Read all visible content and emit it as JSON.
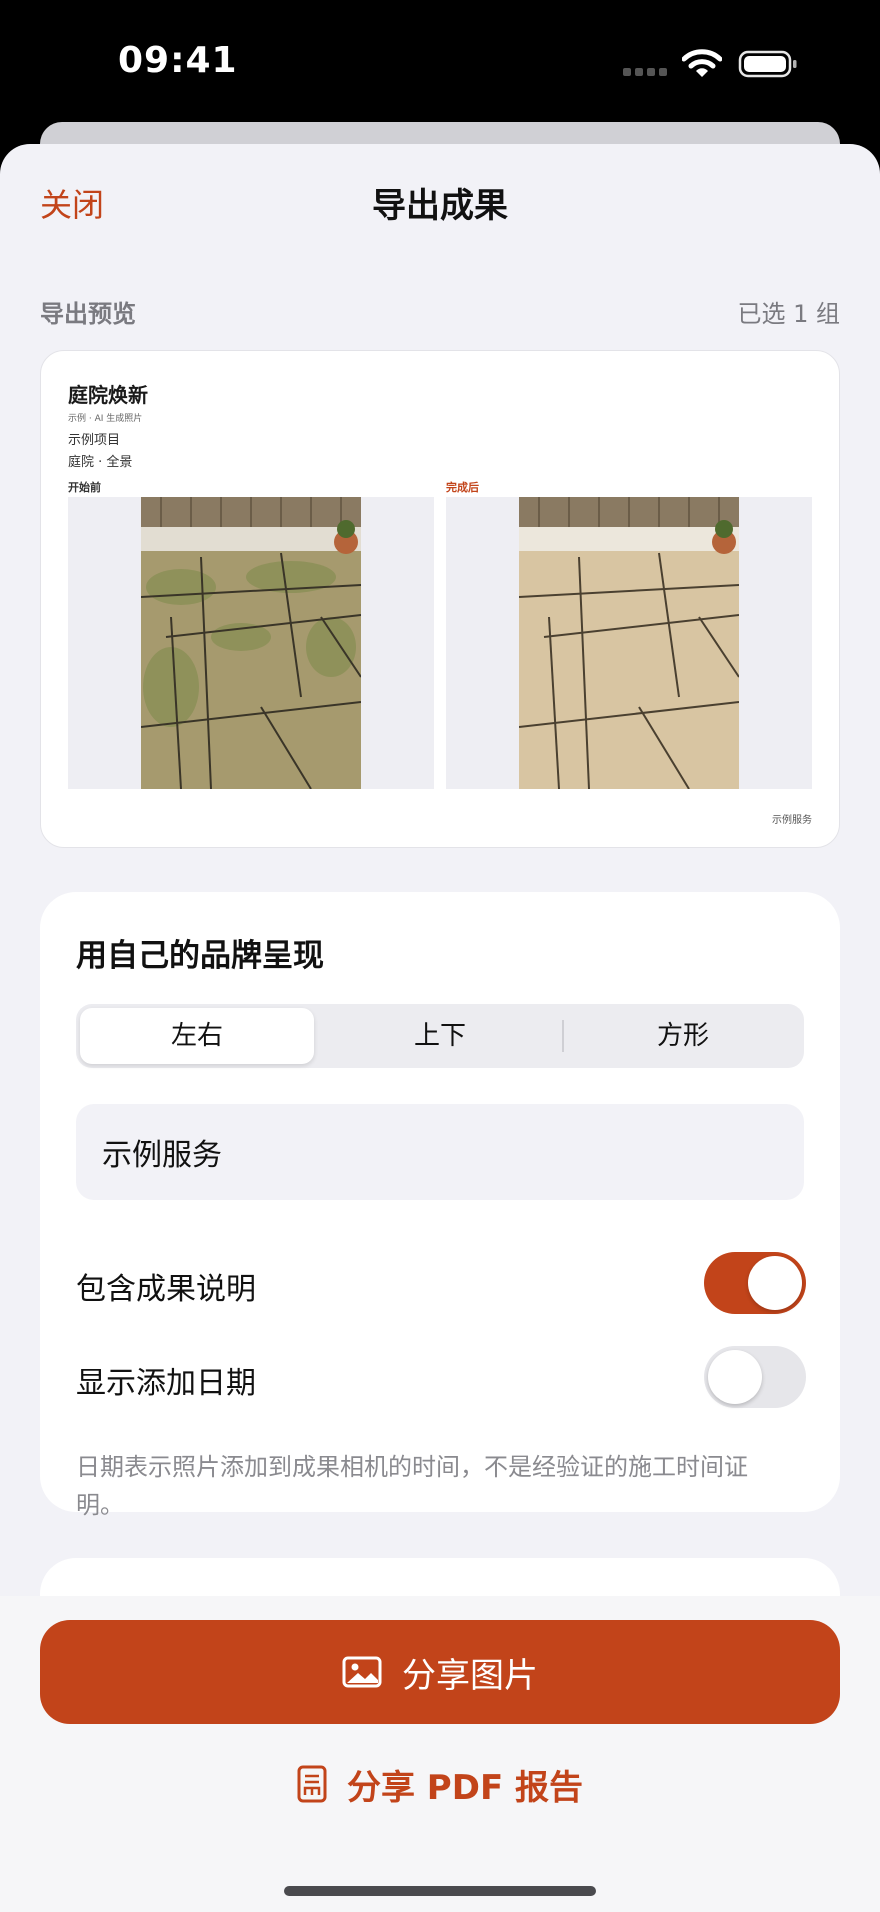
{
  "status_bar": {
    "time": "09:41"
  },
  "nav": {
    "close": "关闭",
    "title": "导出成果"
  },
  "preview_section": {
    "label": "导出预览",
    "count": "已选 1 组"
  },
  "preview": {
    "title": "庭院焕新",
    "subtitle": "示例 · AI 生成照片",
    "project": "示例项目",
    "area": "庭院 · 全景",
    "before_label": "开始前",
    "after_label": "完成后",
    "footer": "示例服务"
  },
  "brand": {
    "title": "用自己的品牌呈现",
    "layouts": [
      "左右",
      "上下",
      "方形"
    ],
    "selected_layout": "左右",
    "business_name": "示例服务",
    "include_notes": {
      "label": "包含成果说明",
      "on": true
    },
    "show_date": {
      "label": "显示添加日期",
      "on": false
    },
    "footnote": "日期表示照片添加到成果相机的时间，不是经验证的施工时间证明。"
  },
  "actions": {
    "share_image": "分享图片",
    "share_pdf": "分享 PDF 报告"
  },
  "colors": {
    "accent": "#c2441a",
    "background": "#f2f2f7"
  },
  "icons": {
    "share_image": "photo-icon",
    "share_pdf": "document-icon"
  }
}
